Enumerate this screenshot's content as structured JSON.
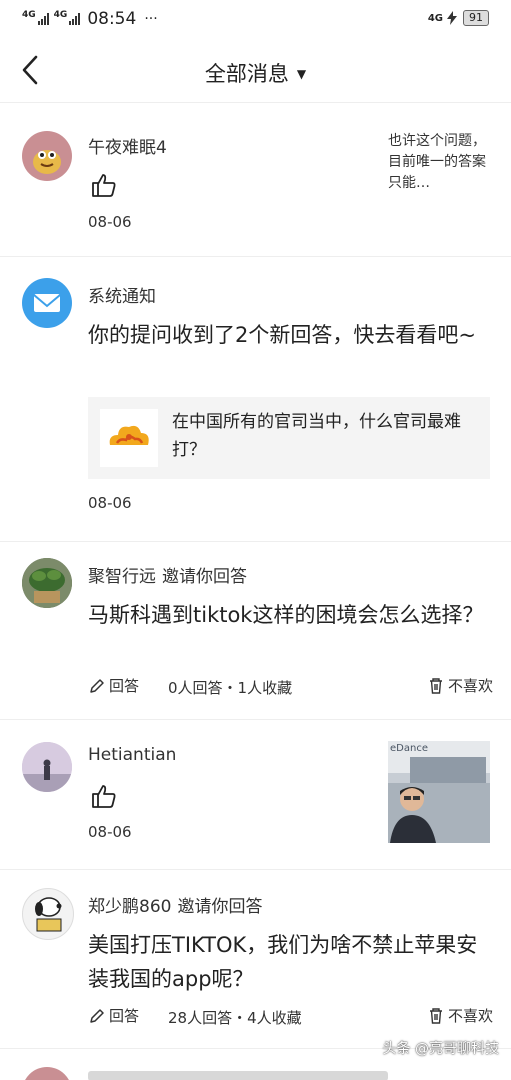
{
  "status_bar": {
    "net1": "4G",
    "net2": "4G",
    "time": "08:54",
    "dots": "···",
    "right_net": "4G",
    "battery": "91"
  },
  "nav": {
    "title": "全部消息"
  },
  "items": [
    {
      "name": "午夜难眠4",
      "date": "08-06",
      "side_text": "也许这个问题，目前唯一的答案只能…"
    },
    {
      "name": "系统通知",
      "body": "你的提问收到了2个新回答，快去看看吧~",
      "quote": "在中国所有的官司当中，什么官司最难打？",
      "date": "08-06"
    },
    {
      "name": "聚智行远",
      "invite": "邀请你回答",
      "question": "马斯科遇到tiktok这样的困境会怎么选择？",
      "answer_label": "回答",
      "stats": "0人回答・1人收藏",
      "dislike_label": "不喜欢"
    },
    {
      "name": "Hetiantian",
      "date": "08-06",
      "thumb_text": "eDance"
    },
    {
      "name": "郑少鹏860",
      "invite": "邀请你回答",
      "question": "美国打压TIKTOK，我们为啥不禁止苹果安装我国的app呢？",
      "answer_label": "回答",
      "stats": "28人回答・4人收藏",
      "dislike_label": "不喜欢"
    }
  ],
  "watermark": "头条 @亮哥聊科技",
  "colors": {
    "accent_blue": "#3ca0ea",
    "text": "#222222",
    "divider": "#eeeeee",
    "card_bg": "#f4f4f4"
  }
}
